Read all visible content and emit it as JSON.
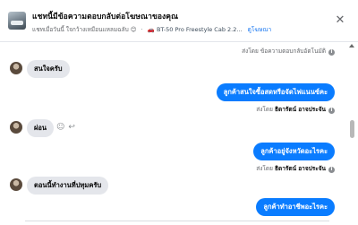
{
  "header": {
    "title": "แชทนี้มีข้อความตอบกลับต่อโฆษณาของคุณ",
    "subtitle_prefix": "แชทเมื่อวันนี้ ใจกว้างเหมือนแหลมฉลับ",
    "subtitle_emoji": "😊",
    "listing": "🚗 BT-50 Pro Freestyle Cab 2.2...",
    "link_label": "ดูโฆษณา"
  },
  "messages": {
    "auto_reply_meta": "ส่งโดย ข้อความตอบกลับอัตโนมัติ",
    "m1": "สนใจครับ",
    "m2": "ลูกค้าสนใจซื้อสดหรือจัดไฟแนนซ์คะ",
    "sent_by_prefix": "ส่งโดย",
    "sender_name": "ธิดารัตน์ อาจประจัน",
    "m3": "ผ่อน",
    "m4": "ลูกค้าอยู่จังหวัดอะไรคะ",
    "m5": "ตอนนี้ทำงานที่ปทุมครับ",
    "m6": "ลูกค้าทำอาชีพอะไรคะ"
  },
  "icons": {
    "close": "close-icon",
    "info": "info-icon",
    "emoji": "smiley-icon",
    "reply": "reply-icon"
  },
  "colors": {
    "outgoing_bubble": "#0a7cff",
    "incoming_bubble": "#e4e6eb",
    "link": "#1877f2"
  }
}
